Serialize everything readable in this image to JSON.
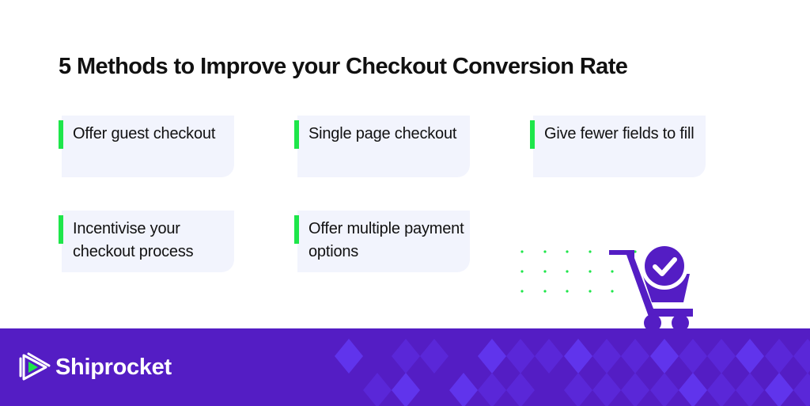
{
  "title": "5 Methods to Improve your Checkout Conversion Rate",
  "methods": [
    {
      "label": "Offer guest checkout"
    },
    {
      "label": "Single page checkout"
    },
    {
      "label": "Give fewer fields to fill"
    },
    {
      "label": "Incentivise your checkout process"
    },
    {
      "label": "Offer multiple payment options"
    }
  ],
  "brand": {
    "name": "Shiprocket",
    "logo_icon": "play-triangle-icon",
    "colors": {
      "primary": "#541dc4",
      "accent_green": "#1ee64a",
      "card_bg": "#f2f4fd",
      "diamond_light": "#6034ec",
      "diamond_mid": "#5a27d8"
    }
  },
  "illustration": {
    "icon": "shopping-cart-check-icon"
  }
}
